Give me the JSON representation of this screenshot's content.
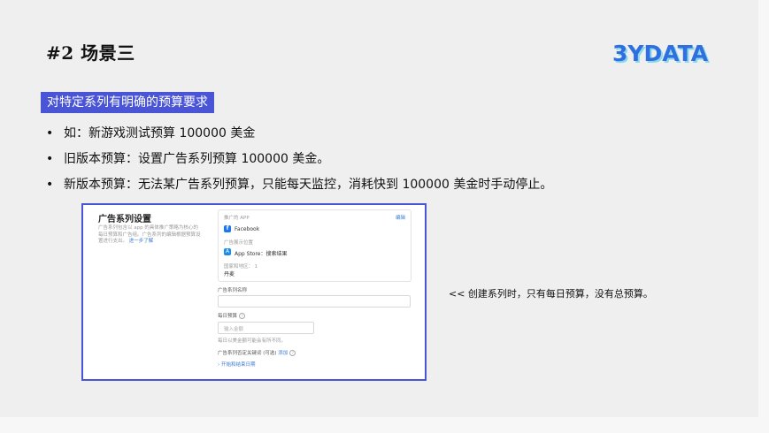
{
  "slide": {
    "title": "#2 场景三",
    "logo_text": "3YDATA",
    "tag": "对特定系列有明确的预算要求",
    "bullets": [
      "如：新游戏测试预算 100000 美金",
      "旧版本预算：设置广告系列预算 100000 美金。",
      "新版本预算：无法某广告系列预算，只能每天监控，消耗快到 100000 美金时手动停止。"
    ],
    "bullet_symbol": "•",
    "note": "<< 创建系列时，只有每日预算，没有总预算。"
  },
  "screenshot": {
    "heading": "广告系列设置",
    "desc": "广告系列包含以 app 的具体推广策略为核心的每日预算和广告组。广告系列的编辑根据预算设置进行支出。",
    "more_link": "进一步了解",
    "card": {
      "app_label": "推广的 APP",
      "edit_link": "编辑",
      "app_name": "Facebook",
      "placement_label": "广告展示位置",
      "placement_value": "App Store：搜索结果",
      "region_label": "国家和地区：",
      "region_count": "1",
      "region_value": "丹麦"
    },
    "name_label": "广告系列名称",
    "budget_label": "每日预算",
    "budget_placeholder": "输入金额",
    "budget_hint": "每日以美金额可能会有所不同。",
    "negative_label": "广告系列否定关键词 (可选)",
    "negative_add": "添加",
    "dates_link": "› 开始和结束日期"
  },
  "colors": {
    "accent": "#4a55d6",
    "logo_primary": "#2f6fe0",
    "logo_secondary": "#5fd0e8",
    "link": "#3a7bd5"
  }
}
